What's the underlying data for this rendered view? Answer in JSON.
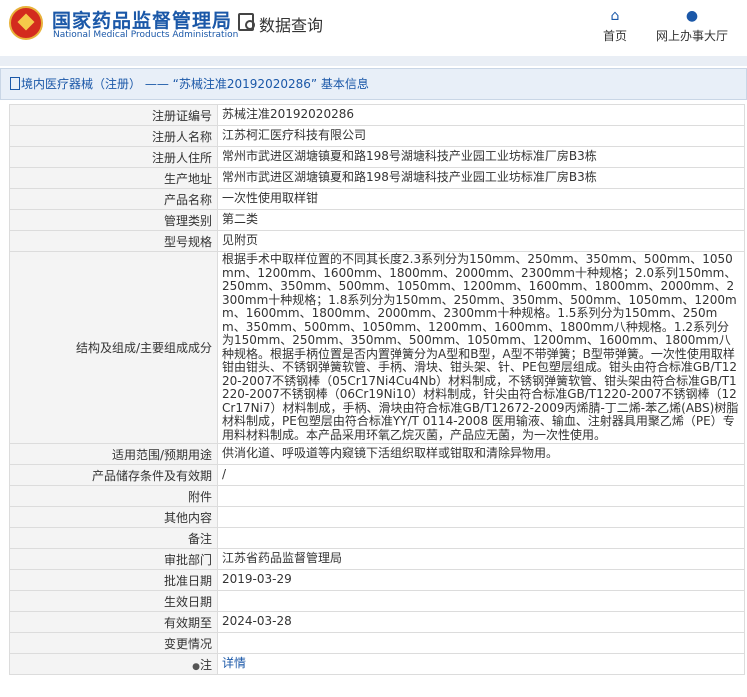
{
  "header": {
    "site_title": "国家药品监督管理局",
    "site_subtitle": "National Medical Products Administration",
    "query_label": "数据查询",
    "nav": {
      "home_label": "首页",
      "service_label": "网上办事大厅"
    }
  },
  "breadcrumb": {
    "prefix": "境内医疗器械（注册）",
    "separator": "——",
    "record": "“苏械注准20192020286”",
    "suffix": "基本信息"
  },
  "fields": [
    {
      "label": "注册证编号",
      "value": "苏械注准20192020286"
    },
    {
      "label": "注册人名称",
      "value": "江苏柯汇医疗科技有限公司"
    },
    {
      "label": "注册人住所",
      "value": "常州市武进区湖塘镇夏和路198号湖塘科技产业园工业坊标准厂房B3栋"
    },
    {
      "label": "生产地址",
      "value": "常州市武进区湖塘镇夏和路198号湖塘科技产业园工业坊标准厂房B3栋"
    },
    {
      "label": "产品名称",
      "value": "一次性使用取样钳"
    },
    {
      "label": "管理类别",
      "value": "第二类"
    },
    {
      "label": "型号规格",
      "value": "见附页"
    },
    {
      "label": "结构及组成/主要组成成分",
      "value": "根据手术中取样位置的不同其长度2.3系列分为150mm、250mm、350mm、500mm、1050mm、1200mm、1600mm、1800mm、2000mm、2300mm十种规格；2.0系列150mm、250mm、350mm、500mm、1050mm、1200mm、1600mm、1800mm、2000mm、2300mm十种规格；1.8系列分为150mm、250mm、350mm、500mm、1050mm、1200mm、1600mm、1800mm、2000mm、2300mm十种规格。1.5系列分为150mm、250mm、350mm、500mm、1050mm、1200mm、1600mm、1800mm八种规格。1.2系列分为150mm、250mm、350mm、500mm、1050mm、1200mm、1600mm、1800mm八种规格。根据手柄位置是否内置弹簧分为A型和B型，A型不带弹簧；B型带弹簧。一次性使用取样钳由钳头、不锈钢弹簧软管、手柄、滑块、钳头架、针、PE包塑层组成。钳头由符合标准GB/T1220-2007不锈钢棒（05Cr17Ni4Cu4Nb）材料制成，不锈钢弹簧软管、钳头架由符合标准GB/T1220-2007不锈钢棒（06Cr19Ni10）材料制成，针尖由符合标准GB/T1220-2007不锈钢棒（12Cr17Ni7）材料制成，手柄、滑块由符合标准GB/T12672-2009丙烯腈-丁二烯-苯乙烯(ABS)树脂材料制成，PE包塑层由符合标准YY/T 0114-2008 医用输液、输血、注射器具用聚乙烯（PE）专用料材料制成。本产品采用环氧乙烷灭菌，产品应无菌，为一次性使用。"
    },
    {
      "label": "适用范围/预期用途",
      "value": "供消化道、呼吸道等内窥镜下活组织取样或钳取和清除异物用。"
    },
    {
      "label": "产品储存条件及有效期",
      "value": "/"
    },
    {
      "label": "附件",
      "value": ""
    },
    {
      "label": "其他内容",
      "value": ""
    },
    {
      "label": "备注",
      "value": ""
    },
    {
      "label": "审批部门",
      "value": "江苏省药品监督管理局"
    },
    {
      "label": "批准日期",
      "value": "2019-03-29"
    },
    {
      "label": "生效日期",
      "value": ""
    },
    {
      "label": "有效期至",
      "value": "2024-03-28"
    },
    {
      "label": "变更情况",
      "value": ""
    }
  ],
  "note": {
    "icon_glyph": "●",
    "label": "注",
    "link_label": "详情"
  },
  "colors": {
    "brand_blue": "#1b58a8",
    "label_bg": "#f4f4f4",
    "bar_bg": "#e8eff8",
    "logo_red": "#d32b1e"
  }
}
